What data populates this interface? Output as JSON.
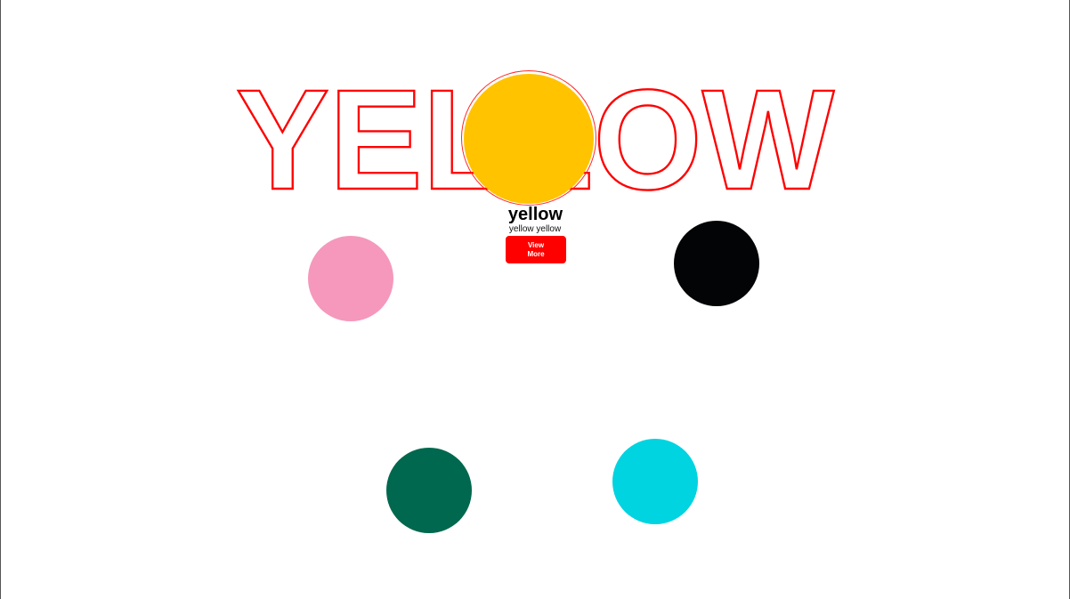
{
  "hero": {
    "big_word": "YELLOW",
    "outline_color": "#ff0000",
    "circle_color": "#ffc300",
    "title": "yellow",
    "subtitle": "yellow yellow",
    "button_label": "View More",
    "button_color": "#ff0000"
  },
  "color_dots": [
    {
      "name": "pink",
      "color": "#f598bc"
    },
    {
      "name": "black",
      "color": "#030405"
    },
    {
      "name": "green",
      "color": "#00684e"
    },
    {
      "name": "cyan",
      "color": "#00d4e0"
    }
  ]
}
